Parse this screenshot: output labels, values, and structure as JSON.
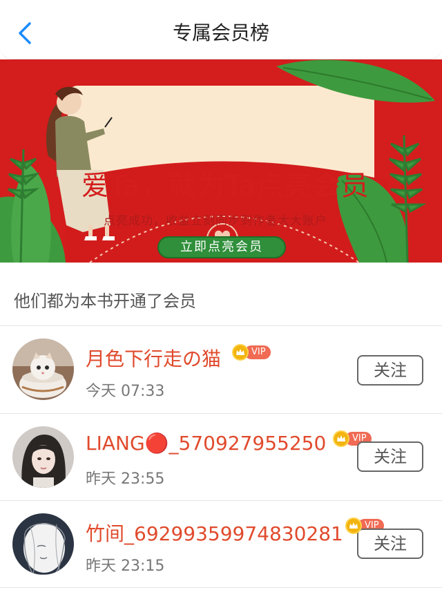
{
  "header": {
    "title": "专属会员榜",
    "back_icon": "chevron-left-icon",
    "accent_color": "#1a8cff"
  },
  "banner": {
    "headline": "爱Ta，就为Ta点亮会员",
    "subline": "点亮成功，收益立刻同步到作者大大账户",
    "cta_label": "立即点亮会员",
    "background_color": "#d41d1d"
  },
  "section": {
    "title": "他们都为本书开通了会员"
  },
  "members": [
    {
      "name": "月色下行走の猫",
      "time": "今天 07:33",
      "badge": "VIP",
      "follow_label": "关注"
    },
    {
      "name": "LIANG🔴_570927955250",
      "time": "昨天 23:55",
      "badge": "VIP",
      "follow_label": "关注"
    },
    {
      "name": "竹间_69299359974830281",
      "time": "昨天 23:15",
      "badge": "VIP",
      "follow_label": "关注"
    }
  ]
}
